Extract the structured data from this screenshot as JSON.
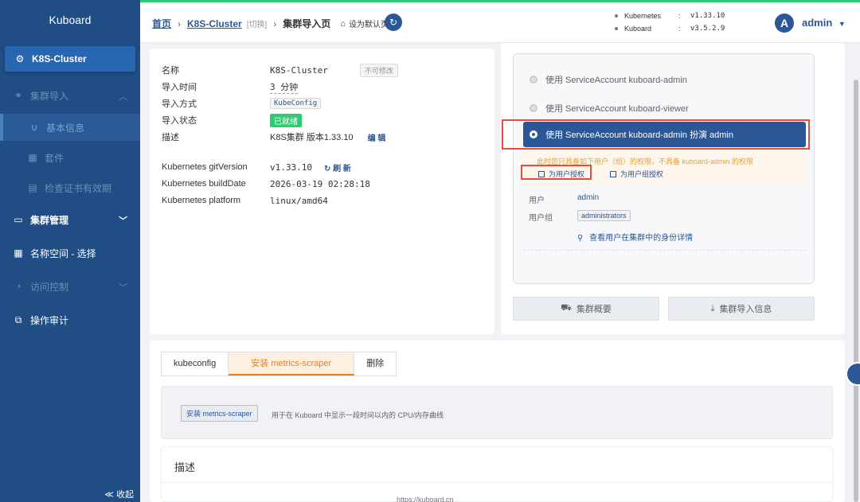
{
  "app": {
    "logo": "Kuboard"
  },
  "sidebar": {
    "cluster": "K8S-Cluster",
    "items": [
      {
        "label": "集群导入"
      },
      {
        "label": "基本信息"
      },
      {
        "label": "套件"
      },
      {
        "label": "检查证书有效期"
      },
      {
        "label": "集群管理"
      },
      {
        "label": "名称空间 - 选择"
      },
      {
        "label": "访问控制"
      },
      {
        "label": "操作审计"
      }
    ],
    "collapse": "≪ 收起"
  },
  "header": {
    "home": "首页",
    "cluster": "K8S-Cluster",
    "switch": "[切换]",
    "current": "集群导入页",
    "set_default": "设为默认页",
    "versions": [
      {
        "name": "Kubernetes",
        "colon": ":",
        "value": "v1.33.10"
      },
      {
        "name": "Kuboard",
        "colon": ":",
        "value": "v3.5.2.9"
      }
    ],
    "avatar_letter": "A",
    "user": "admin"
  },
  "info": {
    "name_label": "名称",
    "name_value": "K8S-Cluster",
    "name_tag": "不可修改",
    "time_label": "导入时间",
    "time_value": "3 分钟",
    "method_label": "导入方式",
    "method_value": "KubeConfig",
    "status_label": "导入状态",
    "status_value": "已就绪",
    "desc_label": "描述",
    "desc_value": "K8S集群 版本1.33.10",
    "edit": "编 辑",
    "git_label": "Kubernetes gitVersion",
    "git_value": "v1.33.10",
    "refresh": "刷 新",
    "build_label": "Kubernetes buildDate",
    "build_value": "2026-03-19 02:28:18",
    "platform_label": "Kubernetes platform",
    "platform_value": "linux/amd64"
  },
  "access": {
    "opt1": "使用 ServiceAccount kuboard-admin",
    "opt2": "使用 ServiceAccount kuboard-viewer",
    "opt3": "使用 ServiceAccount kuboard-admin 扮演 admin",
    "warning": "此时您只具备如下用户（组）的权限，不具备 kuboard-admin 的权限",
    "grant_user": "为用户授权",
    "grant_group": "为用户组授权",
    "user_label": "用户",
    "user_value": "admin",
    "group_label": "用户组",
    "group_value": "administrators",
    "identity_link": "查看用户在集群中的身份详情",
    "btn_overview": "集群概要",
    "btn_import": "集群导入信息"
  },
  "tabs": [
    {
      "label": "kubeconfig"
    },
    {
      "label": "安装 metrics-scraper"
    },
    {
      "label": "删除"
    }
  ],
  "metrics": {
    "install_btn": "安装 metrics-scraper",
    "install_desc": "用于在 Kuboard 中显示一段时间以内的 CPU/内存曲线"
  },
  "desc_card": {
    "title": "描述"
  },
  "footer": {
    "url": "https://kuboard.cn"
  }
}
